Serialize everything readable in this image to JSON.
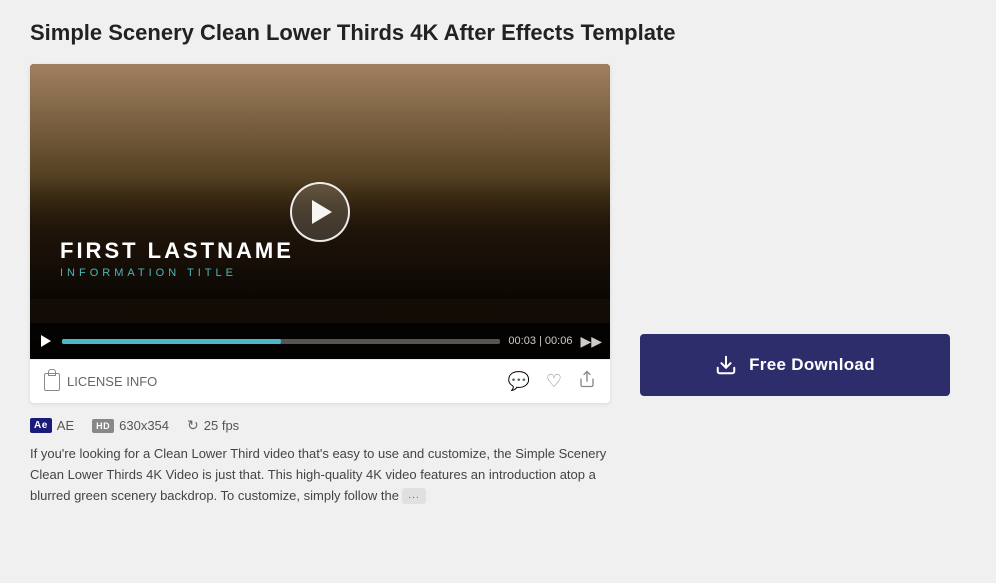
{
  "page": {
    "title": "Simple Scenery Clean Lower Thirds 4K After Effects Template"
  },
  "video": {
    "overlay_name": "FIRST LASTNAME",
    "overlay_subtitle": "INFORMATION TITLE",
    "time_current": "00:03",
    "time_total": "00:06",
    "progress_percent": 50
  },
  "info_bar": {
    "license_label": "LICENSE INFO",
    "comment_icon": "comment-icon",
    "heart_icon": "heart-icon",
    "share_icon": "share-icon"
  },
  "meta": {
    "software_badge": "Ae",
    "software_label": "AE",
    "resolution_badge": "HD",
    "resolution_label": "630x354",
    "fps_label": "25 fps"
  },
  "description": {
    "text": "If you're looking for a Clean Lower Third video that's easy to use and customize, the Simple Scenery Clean Lower Thirds 4K Video is just that. This high-quality 4K video features an introduction atop a blurred green scenery backdrop. To customize, simply follow the",
    "ellipsis": "..."
  },
  "download": {
    "button_label": "Free Download",
    "icon": "download-icon"
  }
}
